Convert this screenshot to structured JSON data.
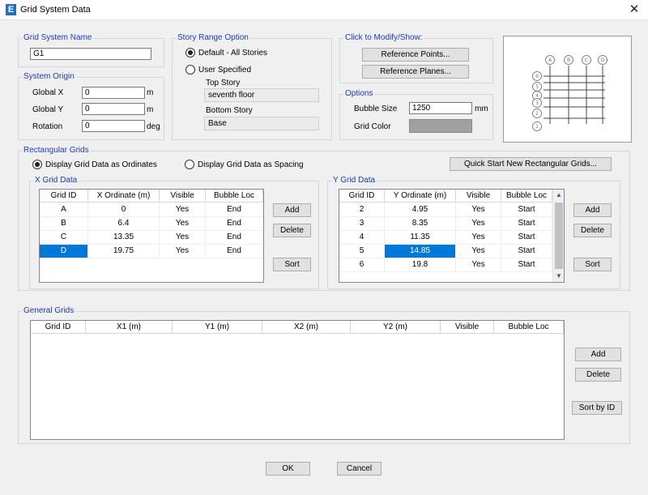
{
  "window": {
    "title": "Grid System Data",
    "icon_letter": "E"
  },
  "grid_system_name": {
    "label": "Grid System Name",
    "value": "G1"
  },
  "system_origin": {
    "label": "System Origin",
    "global_x": {
      "label": "Global  X",
      "value": "0",
      "unit": "m"
    },
    "global_y": {
      "label": "Global  Y",
      "value": "0",
      "unit": "m"
    },
    "rotation": {
      "label": "Rotation",
      "value": "0",
      "unit": "deg"
    }
  },
  "story_range": {
    "label": "Story Range Option",
    "option_default": "Default - All Stories",
    "option_user": "User Specified",
    "top_story_label": "Top Story",
    "top_story_value": "seventh floor",
    "bottom_story_label": "Bottom Story",
    "bottom_story_value": "Base"
  },
  "click_modify": {
    "label": "Click to Modify/Show:",
    "reference_points": "Reference Points...",
    "reference_planes": "Reference Planes..."
  },
  "options": {
    "label": "Options",
    "bubble_size_label": "Bubble Size",
    "bubble_size_value": "1250",
    "bubble_size_unit": "mm",
    "grid_color_label": "Grid Color",
    "grid_color": "#a0a0a0"
  },
  "preview": {
    "x_bubbles": [
      "A",
      "B",
      "C",
      "D"
    ],
    "y_bubbles": [
      "6",
      "5",
      "4",
      "3",
      "2",
      "1"
    ]
  },
  "rect_grids": {
    "label": "Rectangular Grids",
    "opt_ordinates": "Display Grid Data as Ordinates",
    "opt_spacing": "Display Grid Data as Spacing",
    "quick_start": "Quick Start New Rectangular Grids..."
  },
  "x_grid": {
    "label": "X Grid Data",
    "columns": [
      "Grid ID",
      "X Ordinate (m)",
      "Visible",
      "Bubble Loc"
    ],
    "rows": [
      [
        "A",
        "0",
        "Yes",
        "End"
      ],
      [
        "B",
        "6.4",
        "Yes",
        "End"
      ],
      [
        "C",
        "13.35",
        "Yes",
        "End"
      ],
      [
        "D",
        "19.75",
        "Yes",
        "End"
      ]
    ],
    "add": "Add",
    "delete": "Delete",
    "sort": "Sort"
  },
  "y_grid": {
    "label": "Y Grid Data",
    "columns": [
      "Grid ID",
      "Y Ordinate (m)",
      "Visible",
      "Bubble Loc"
    ],
    "rows": [
      [
        "2",
        "4.95",
        "Yes",
        "Start"
      ],
      [
        "3",
        "8.35",
        "Yes",
        "Start"
      ],
      [
        "4",
        "11.35",
        "Yes",
        "Start"
      ],
      [
        "5",
        "14.85",
        "Yes",
        "Start"
      ],
      [
        "6",
        "19.8",
        "Yes",
        "Start"
      ]
    ],
    "add": "Add",
    "delete": "Delete",
    "sort": "Sort"
  },
  "general_grids": {
    "label": "General Grids",
    "columns": [
      "Grid ID",
      "X1 (m)",
      "Y1 (m)",
      "X2 (m)",
      "Y2 (m)",
      "Visible",
      "Bubble Loc"
    ],
    "add": "Add",
    "delete": "Delete",
    "sort_by_id": "Sort by ID"
  },
  "footer": {
    "ok": "OK",
    "cancel": "Cancel"
  }
}
